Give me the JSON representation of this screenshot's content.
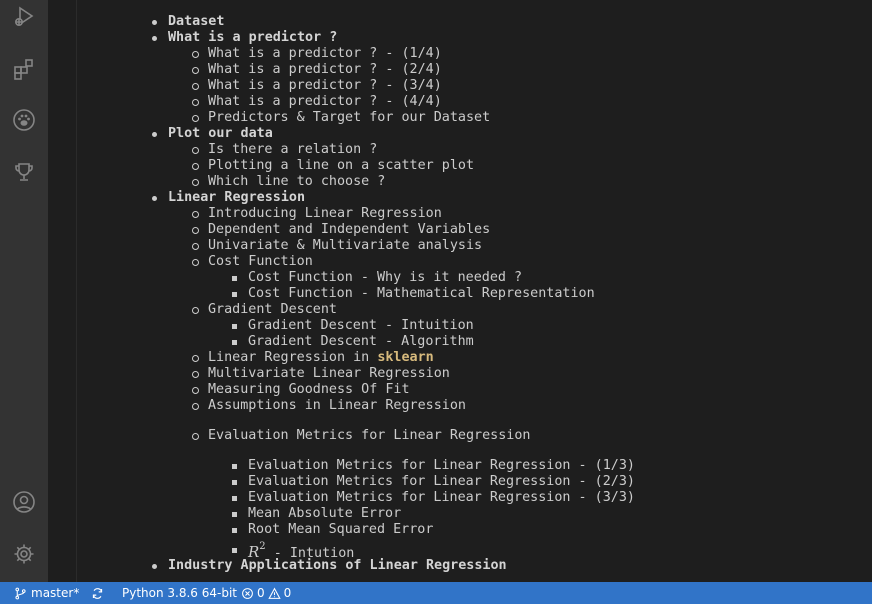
{
  "activity_bar": {
    "icons": [
      "run-debug-icon",
      "extensions-icon",
      "paw-icon",
      "trophy-icon",
      "account-icon",
      "settings-gear-icon"
    ]
  },
  "outline": {
    "l1": "Dataset",
    "l2": "What is a predictor ?",
    "l3": "What is a predictor ? - (1/4)",
    "l4": "What is a predictor ? - (2/4)",
    "l5": "What is a predictor ? - (3/4)",
    "l6": "What is a predictor ? - (4/4)",
    "l7": "Predictors & Target for our Dataset",
    "l8": "Plot our data",
    "l9": "Is there a relation ?",
    "l10": "Plotting a line on a scatter plot",
    "l11": "Which line to choose ?",
    "l12": "Linear Regression",
    "l13": "Introducing Linear Regression",
    "l14": "Dependent and Independent Variables",
    "l15": "Univariate & Multivariate analysis",
    "l16": "Cost Function",
    "l17": "Cost Function - Why is it needed ?",
    "l18": "Cost Function - Mathematical Representation",
    "l19": "Gradient Descent",
    "l20": "Gradient Descent - Intuition",
    "l21": "Gradient Descent - Algorithm",
    "l22a": "Linear Regression in ",
    "l22b": "sklearn",
    "l23": "Multivariate Linear Regression",
    "l24": "Measuring Goodness Of Fit",
    "l25": "Assumptions in Linear Regression",
    "l26": "Evaluation Metrics for Linear Regression",
    "l27": "Evaluation Metrics for Linear Regression - (1/3)",
    "l28": "Evaluation Metrics for Linear Regression - (2/3)",
    "l29": "Evaluation Metrics for Linear Regression - (3/3)",
    "l30": "Mean Absolute Error",
    "l31": "Root Mean Squared Error",
    "l32_math_base": "R",
    "l32_math_sup": "2",
    "l32_text": " - Intution",
    "l33": "Industry Applications of Linear Regression"
  },
  "status_bar": {
    "branch": "master*",
    "interpreter": "Python 3.8.6 64-bit",
    "errors": "0",
    "warnings": "0"
  },
  "colors": {
    "status_bar_bg": "#3174c8",
    "activity_bar_bg": "#333333",
    "editor_bg": "#1e1e1e",
    "highlight": "#d7ba7d"
  }
}
